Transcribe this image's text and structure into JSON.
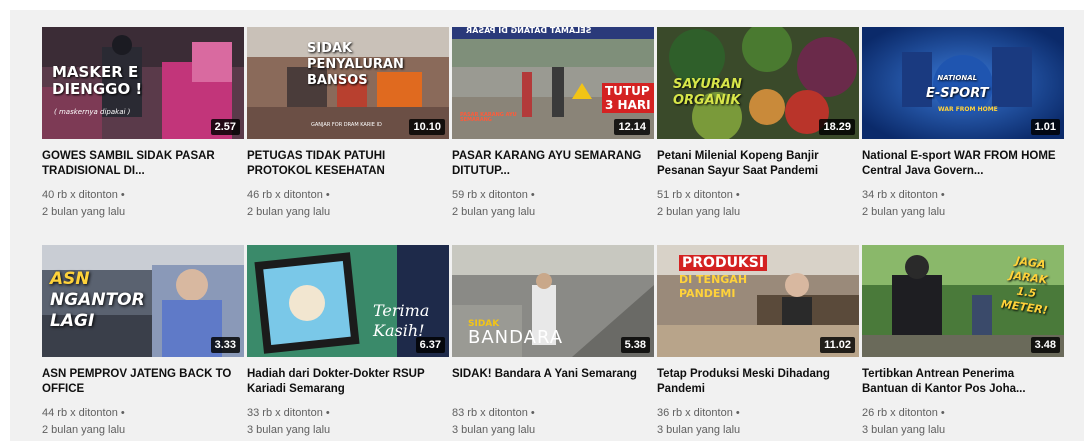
{
  "videos": [
    {
      "title": "GOWES SAMBIL SIDAK PASAR TRADISIONAL DI...",
      "views": "40 rb x ditonton •",
      "age": "2 bulan yang lalu",
      "duration": "2.57",
      "overlay": [
        "MASKER E",
        "DIENGGO !"
      ],
      "overlay_sub": "( maskernya dipakai )"
    },
    {
      "title": "PETUGAS TIDAK PATUHI PROTOKOL KESEHATAN",
      "views": "46 rb x ditonton •",
      "age": "2 bulan yang lalu",
      "duration": "10.10",
      "overlay": [
        "SIDAK",
        "PENYALURAN",
        "BANSOS"
      ],
      "overlay_sub": "GANJAR FOR DRAM KARIE ID"
    },
    {
      "title": "PASAR KARANG AYU SEMARANG DITUTUP...",
      "views": "59 rb x ditonton •",
      "age": "2 bulan yang lalu",
      "duration": "12.14",
      "overlay": [
        "TUTUP",
        "3 HARI"
      ],
      "overlay_sub": "PASAR KARANG AYU SEMARANG",
      "banner": "SELAMAT DATANG DI PASAR"
    },
    {
      "title": "Petani Milenial Kopeng Banjir Pesanan Sayur Saat Pandemi",
      "views": "51 rb x ditonton •",
      "age": "2 bulan yang lalu",
      "duration": "18.29",
      "overlay": [
        "SAYURAN",
        "ORGANIK"
      ]
    },
    {
      "title": "National E-sport WAR FROM HOME Central Java Govern...",
      "views": "34 rb x ditonton •",
      "age": "2 bulan yang lalu",
      "duration": "1.01",
      "overlay": [
        "NATIONAL",
        "E-SPORT"
      ],
      "overlay_sub": "WAR FROM HOME"
    },
    {
      "title": "ASN PEMPROV JATENG BACK TO OFFICE",
      "views": "44 rb x ditonton •",
      "age": "2 bulan yang lalu",
      "duration": "3.33",
      "overlay": [
        "ASN",
        "NGANTOR",
        "LAGI"
      ]
    },
    {
      "title": "Hadiah dari Dokter-Dokter RSUP Kariadi Semarang",
      "views": "33 rb x ditonton •",
      "age": "3 bulan yang lalu",
      "duration": "6.37",
      "overlay": [
        "Terima",
        "Kasih!"
      ]
    },
    {
      "title": "SIDAK! Bandara A Yani Semarang",
      "views": "83 rb x ditonton •",
      "age": "3 bulan yang lalu",
      "duration": "5.38",
      "overlay": [
        "SIDAK",
        "BANDARA"
      ]
    },
    {
      "title": "Tetap Produksi Meski Dihadang Pandemi",
      "views": "36 rb x ditonton •",
      "age": "3 bulan yang lalu",
      "duration": "11.02",
      "overlay": [
        "PRODUKSI",
        "DI TENGAH",
        "PANDEMI"
      ]
    },
    {
      "title": "Tertibkan Antrean Penerima Bantuan di Kantor Pos Joha...",
      "views": "26 rb x ditonton •",
      "age": "3 bulan yang lalu",
      "duration": "3.48",
      "overlay": [
        "JAGA",
        "JARAK",
        "1.5",
        "METER!"
      ]
    }
  ]
}
